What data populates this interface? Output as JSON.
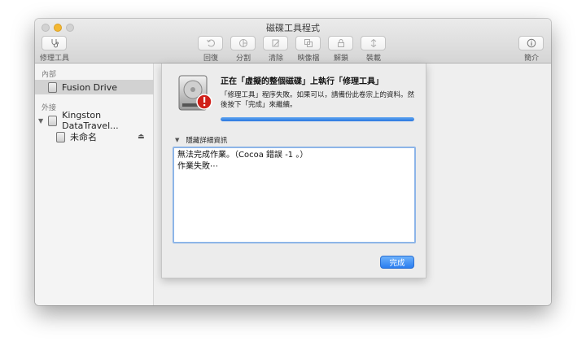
{
  "window": {
    "title": "磁碟工具程式"
  },
  "toolbar": {
    "first_aid": "修理工具",
    "restore": "回復",
    "partition": "分割",
    "erase": "清除",
    "mount_image": "映像檔",
    "unmount": "解鎖",
    "mount": "裝載",
    "info": "簡介"
  },
  "sidebar": {
    "internal_header": "內部",
    "internal_items": [
      {
        "label": "Fusion Drive",
        "selected": true
      }
    ],
    "external_header": "外接",
    "external_items": [
      {
        "label": "Kingston DataTravel...",
        "expanded": true
      },
      {
        "label": "未命名",
        "ejectable": true
      }
    ]
  },
  "sheet": {
    "title": "正在「虛擬的整個磁碟」上執行「修理工具」",
    "message": "「修理工具」程序失敗。如果可以，請備份此卷宗上的資料。然後按下「完成」來繼續。",
    "progress": 1.0,
    "details_toggle": "隱藏詳細資訊",
    "log_lines": [
      "無法完成作業。（Cocoa 錯誤 -1 。）",
      "作業失敗⋯"
    ],
    "done_button": "完成"
  },
  "colors": {
    "accent": "#2b78e0",
    "warning": "#d0201a",
    "minimize": "#f3b732"
  }
}
